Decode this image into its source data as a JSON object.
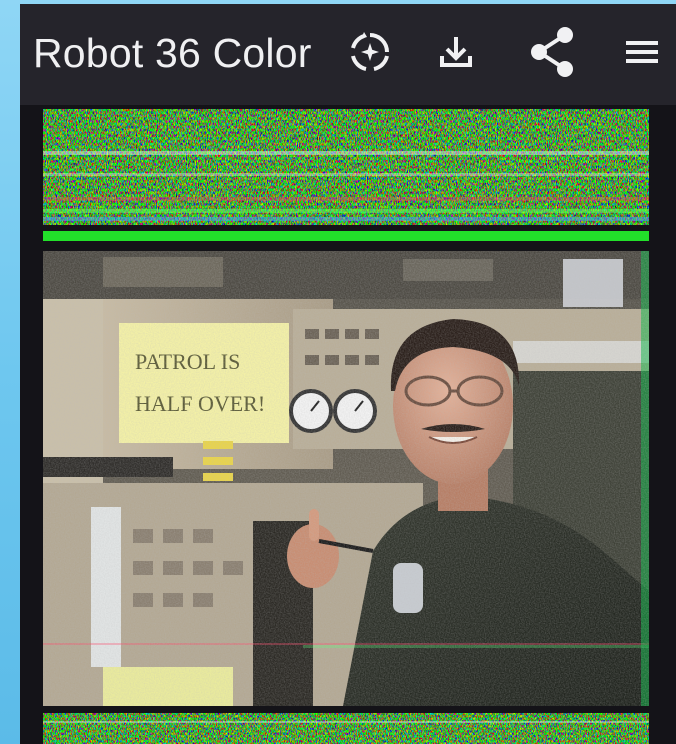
{
  "toolbar": {
    "title": "Robot 36 Color",
    "icons": {
      "new_image": "decode-new-icon",
      "save": "download-icon",
      "share": "share-icon",
      "menu": "menu-icon"
    }
  },
  "colors": {
    "appbar_background": "#25242b",
    "screen_background": "#141318",
    "outer_background": "#6ec7ef",
    "icon_color": "#f1f1f3"
  }
}
